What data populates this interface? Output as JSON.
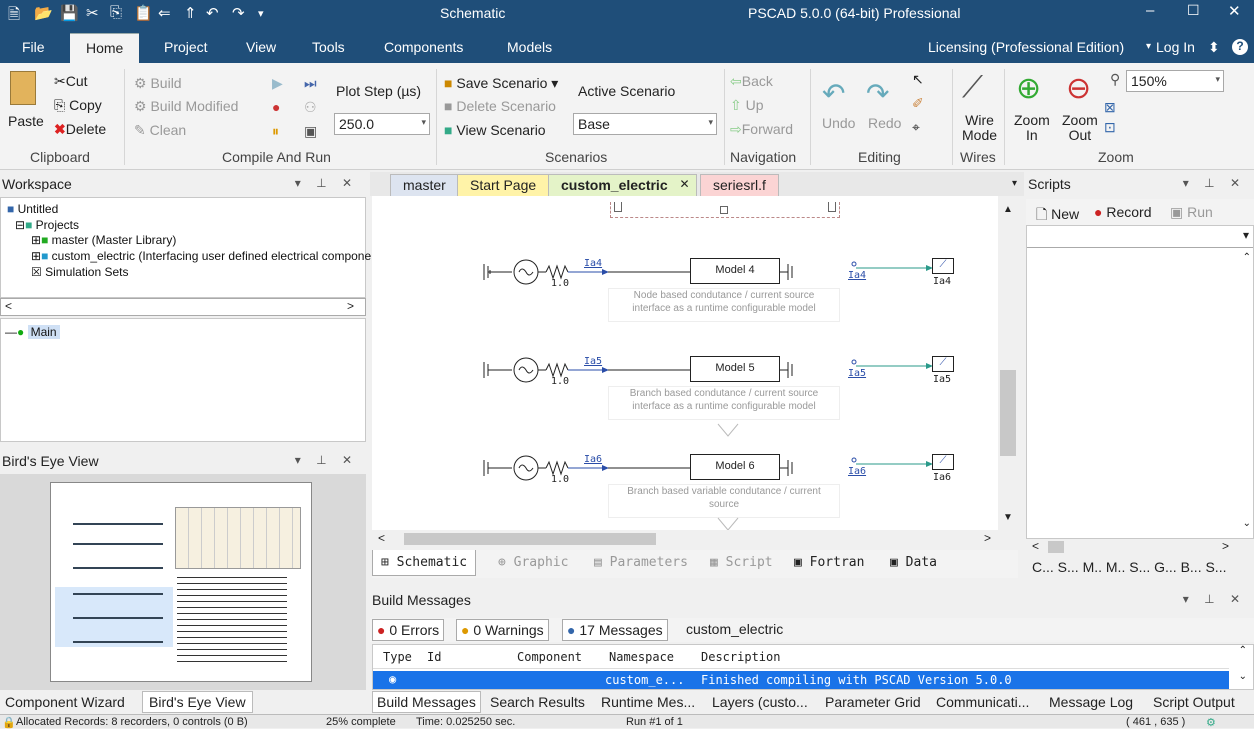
{
  "window": {
    "title": "Schematic",
    "app_title": "PSCAD 5.0.0 (64-bit) Professional"
  },
  "ribbon_tabs": [
    {
      "label": "File"
    },
    {
      "label": "Home"
    },
    {
      "label": "Project"
    },
    {
      "label": "View"
    },
    {
      "label": "Tools"
    },
    {
      "label": "Components"
    },
    {
      "label": "Models"
    }
  ],
  "licensing": {
    "label": "Licensing (Professional Edition)",
    "login": "Log In"
  },
  "clipboard": {
    "paste": "Paste",
    "cut": "Cut",
    "copy": "Copy",
    "delete": "Delete",
    "group": "Clipboard"
  },
  "compile": {
    "build": "Build",
    "build_modified": "Build Modified",
    "clean": "Clean",
    "plot_step_label": "Plot Step (µs)",
    "plot_step_value": "250.0",
    "group": "Compile And Run"
  },
  "scenarios": {
    "save": "Save Scenario",
    "delete": "Delete Scenario",
    "view": "View Scenario",
    "active_label": "Active Scenario",
    "active_value": "Base",
    "group": "Scenarios"
  },
  "navigation": {
    "back": "Back",
    "up": "Up",
    "forward": "Forward",
    "group": "Navigation"
  },
  "editing": {
    "undo": "Undo",
    "redo": "Redo",
    "group": "Editing"
  },
  "wires": {
    "wire_mode_1": "Wire",
    "wire_mode_2": "Mode",
    "group": "Wires"
  },
  "zoom": {
    "zoom_in_1": "Zoom",
    "zoom_in_2": "In",
    "zoom_out_1": "Zoom",
    "zoom_out_2": "Out",
    "level": "150%",
    "group": "Zoom"
  },
  "workspace": {
    "title": "Workspace",
    "tree": [
      "Untitled",
      "Projects",
      "master (Master Library)",
      "custom_electric (Interfacing user defined electrical compone",
      "Simulation Sets"
    ],
    "sub": [
      "Main"
    ]
  },
  "birds_eye": {
    "title": "Bird's Eye View"
  },
  "doc_tabs": [
    {
      "label": "master"
    },
    {
      "label": "Start Page"
    },
    {
      "label": "custom_electric"
    },
    {
      "label": "seriesrl.f"
    }
  ],
  "schematic": {
    "rows": [
      {
        "current": "Ia4",
        "res": "1.0",
        "model": "Model 4",
        "note1": "Node based condutance / current source",
        "note2": "interface as a runtime configurable model",
        "meter": "Ia4",
        "plot": "Ia4"
      },
      {
        "current": "Ia5",
        "res": "1.0",
        "model": "Model 5",
        "note1": "Branch based condutance / current source",
        "note2": "interface as a runtime configurable model",
        "meter": "Ia5",
        "plot": "Ia5"
      },
      {
        "current": "Ia6",
        "res": "1.0",
        "model": "Model 6",
        "note1": "Branch based variable condutance / current",
        "note2": "source",
        "meter": "Ia6",
        "plot": "Ia6"
      }
    ]
  },
  "view_tabs": [
    {
      "label": "Schematic"
    },
    {
      "label": "Graphic"
    },
    {
      "label": "Parameters"
    },
    {
      "label": "Script"
    },
    {
      "label": "Fortran"
    },
    {
      "label": "Data"
    }
  ],
  "scripts": {
    "title": "Scripts",
    "new": "New",
    "record": "Record",
    "run": "Run",
    "tabs": "C... S... M.. M.. S... G... B... S..."
  },
  "build_messages": {
    "title": "Build Messages",
    "errors": "0 Errors",
    "warnings": "0 Warnings",
    "messages": "17 Messages",
    "project": "custom_electric",
    "columns": [
      "Type",
      "Id",
      "Component",
      "Namespace",
      "Description"
    ],
    "row": {
      "namespace": "custom_e...",
      "description": "Finished compiling with PSCAD Version 5.0.0"
    }
  },
  "left_bottom_tabs": [
    {
      "label": "Component Wizard"
    },
    {
      "label": "Bird's Eye View"
    }
  ],
  "bottom_tabs": [
    {
      "label": "Build Messages"
    },
    {
      "label": "Search Results"
    },
    {
      "label": "Runtime Mes..."
    },
    {
      "label": "Layers (custo..."
    },
    {
      "label": "Parameter Grid"
    },
    {
      "label": "Communicati..."
    },
    {
      "label": "Message Log"
    },
    {
      "label": "Script Output"
    }
  ],
  "status": {
    "records": "Allocated Records: 8 recorders, 0 controls (0 B)",
    "progress": "25% complete",
    "time": "Time: 0.025250 sec.",
    "run": "Run #1 of 1",
    "coords": "( 461 , 635 )"
  },
  "colors": {
    "title_bg": "#1f4e79",
    "accent_blue": "#1a73e8",
    "wire_teal": "#2a9a8a"
  }
}
